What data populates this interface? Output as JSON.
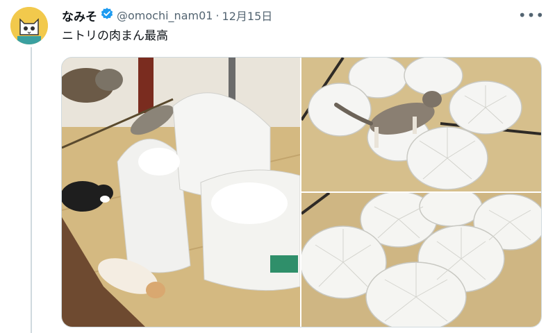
{
  "author": {
    "display_name": "なみそ",
    "handle": "@omochi_nam01",
    "separator": "·",
    "date": "12月15日",
    "avatar_icon": "cat-avatar-icon",
    "verified_icon": "verified-badge-icon"
  },
  "tweet": {
    "text": "ニトリの肉まん最高"
  },
  "more_icon": "more-options-icon",
  "colors": {
    "verified": "#1d9bf0",
    "text": "#0f1419",
    "secondary": "#536471",
    "border": "#cfd9de",
    "tatami": "#d9c08a"
  },
  "media": {
    "photos": [
      {
        "subject": "cats-with-shopping-bags-photo"
      },
      {
        "subject": "cat-on-bun-cushions-photo"
      },
      {
        "subject": "bun-cushions-photo"
      }
    ]
  }
}
